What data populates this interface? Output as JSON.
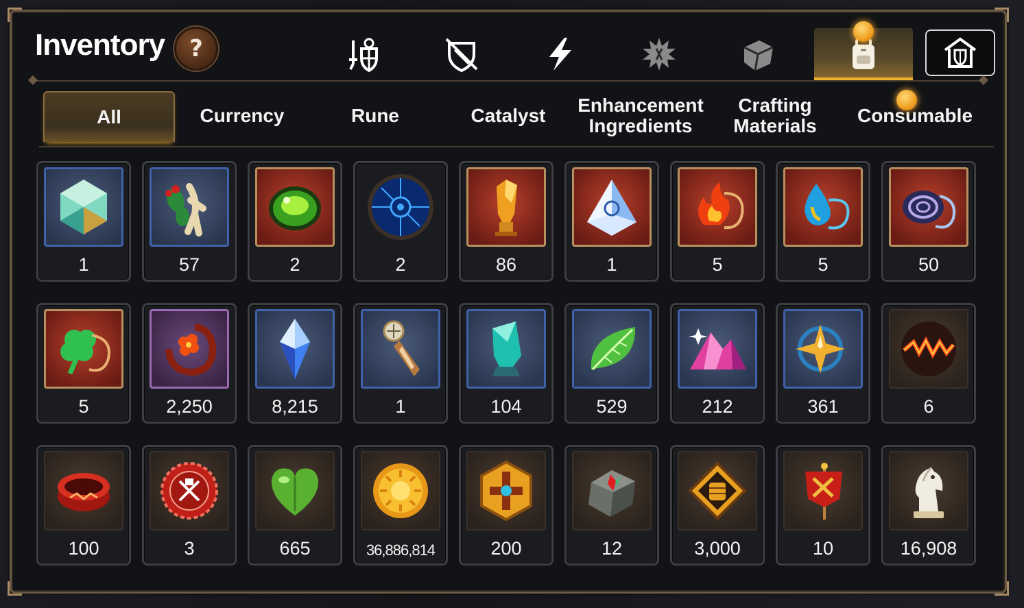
{
  "window": {
    "title": "Inventory",
    "help_label": "?"
  },
  "category_tabs": [
    {
      "icon": "warrior-shield-icon",
      "active": false
    },
    {
      "icon": "crossed-shield-icon",
      "active": false
    },
    {
      "icon": "lightning-bolt-icon",
      "active": false
    },
    {
      "icon": "spiky-gear-icon",
      "active": false
    },
    {
      "icon": "cube-icon",
      "active": false
    },
    {
      "icon": "backpack-icon",
      "active": true
    },
    {
      "icon": "shield-house-icon",
      "active": false
    }
  ],
  "sub_tabs": [
    {
      "label": "All",
      "active": true
    },
    {
      "label": "Currency",
      "active": false
    },
    {
      "label": "Rune",
      "active": false
    },
    {
      "label": "Catalyst",
      "active": false
    },
    {
      "label": "Enhancement\nIngredients",
      "active": false
    },
    {
      "label": "Crafting\nMaterials",
      "active": false
    },
    {
      "label": "Consumable",
      "active": false
    }
  ],
  "items": [
    {
      "icon": "crystal-gem-icon",
      "qty": "1"
    },
    {
      "icon": "ginseng-root-icon",
      "qty": "57"
    },
    {
      "icon": "green-orb-icon",
      "qty": "2"
    },
    {
      "icon": "blue-rune-circle-icon",
      "qty": "2"
    },
    {
      "icon": "amber-crystal-icon",
      "qty": "86"
    },
    {
      "icon": "pyramid-gem-icon",
      "qty": "1"
    },
    {
      "icon": "fire-amulet-icon",
      "qty": "5"
    },
    {
      "icon": "water-amulet-icon",
      "qty": "5"
    },
    {
      "icon": "spiral-amulet-icon",
      "qty": "50"
    },
    {
      "icon": "clover-amulet-icon",
      "qty": "5"
    },
    {
      "icon": "flower-amulet-icon",
      "qty": "2,250"
    },
    {
      "icon": "blue-crystal-icon",
      "qty": "8,215"
    },
    {
      "icon": "compass-pendant-icon",
      "qty": "1"
    },
    {
      "icon": "teal-crystal-icon",
      "qty": "104"
    },
    {
      "icon": "green-leaf-icon",
      "qty": "529"
    },
    {
      "icon": "pink-crystal-pile-icon",
      "qty": "212"
    },
    {
      "icon": "star-amulet-icon",
      "qty": "361"
    },
    {
      "icon": "lava-orb-icon",
      "qty": "6"
    },
    {
      "icon": "red-bracelet-icon",
      "qty": "100"
    },
    {
      "icon": "red-badge-icon",
      "qty": "3"
    },
    {
      "icon": "green-heart-icon",
      "qty": "665"
    },
    {
      "icon": "gold-sun-coin-icon",
      "qty": "36,886,814"
    },
    {
      "icon": "gold-cross-emblem-icon",
      "qty": "200"
    },
    {
      "icon": "stone-compass-icon",
      "qty": "12"
    },
    {
      "icon": "fist-badge-icon",
      "qty": "3,000"
    },
    {
      "icon": "war-banner-icon",
      "qty": "10"
    },
    {
      "icon": "white-knight-icon",
      "qty": "16,908"
    }
  ],
  "colors": {
    "accent": "#f0b030",
    "frame": "#6b5a43",
    "slot_border": "#3e3f44",
    "panel_bg": "#121316"
  }
}
